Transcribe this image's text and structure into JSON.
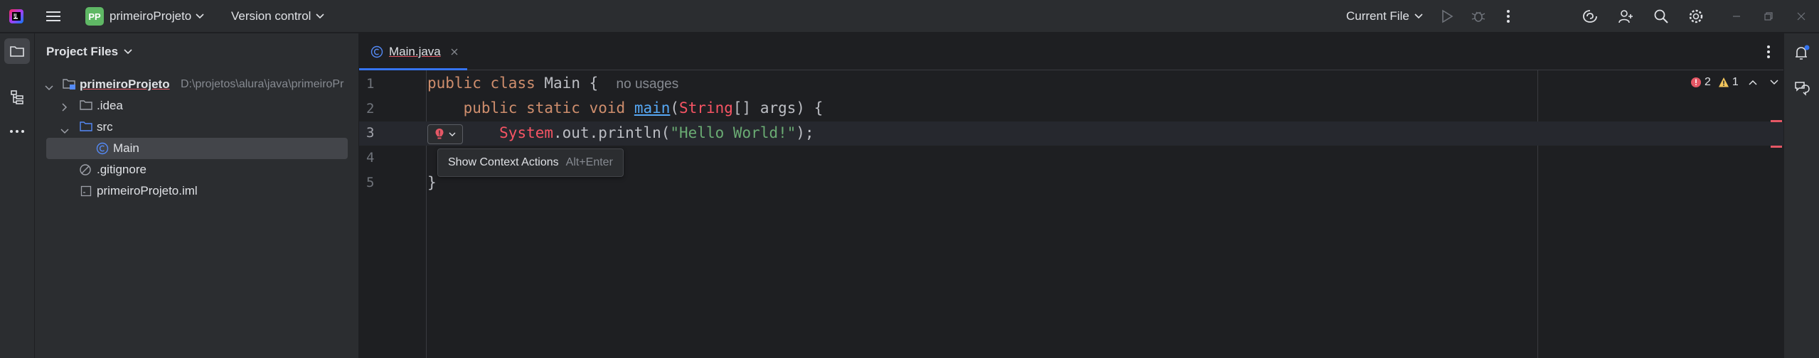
{
  "topbar": {
    "project_badge": "PP",
    "project_name": "primeiroProjeto",
    "vcs_label": "Version control",
    "run_config": "Current File"
  },
  "project_panel": {
    "title": "Project Files",
    "tree": [
      {
        "label": "primeiroProjeto",
        "path": "D:\\projetos\\alura\\java\\primeiroPr"
      },
      {
        "label": ".idea"
      },
      {
        "label": "src"
      },
      {
        "label": "Main"
      },
      {
        "label": ".gitignore"
      },
      {
        "label": "primeiroProjeto.iml"
      }
    ]
  },
  "editor": {
    "tab_label": "Main.java",
    "line_numbers": [
      "1",
      "2",
      "3",
      "4",
      "5"
    ],
    "inlay_hint": "no usages",
    "code": {
      "l1_public": "public",
      "l1_class": "class",
      "l1_rest": "Main {",
      "l2_mods": "public static void",
      "l2_main": "main",
      "l2_paren": "(",
      "l2_type": "String",
      "l2_rest": "[] args) {",
      "l3_system": "System",
      "l3_mid": ".out.println(",
      "l3_str": "\"Hello World!\"",
      "l3_end": ");",
      "l5": "}"
    },
    "errors_count": "2",
    "warnings_count": "1",
    "tooltip": {
      "label": "Show Context Actions",
      "shortcut": "Alt+Enter"
    }
  },
  "colors": {
    "accent": "#3574f0",
    "error": "#e55765",
    "warning": "#f2c55c",
    "project_badge": "#5fb865"
  }
}
